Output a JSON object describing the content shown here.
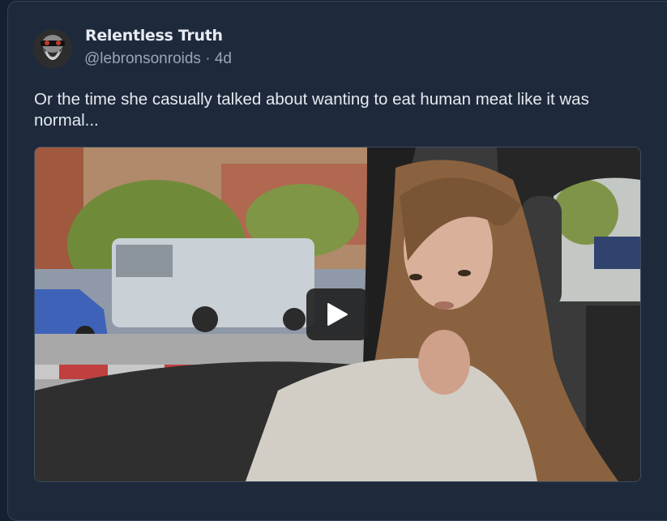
{
  "post": {
    "author": {
      "display_name": "Relentless Truth",
      "handle": "@lebronsonroids",
      "age": "4d",
      "separator": " · "
    },
    "text": "Or the time she casually talked about wanting to eat human meat like it was normal...",
    "media": {
      "type": "video",
      "play_icon": "play-icon"
    }
  },
  "colors": {
    "background": "#152030",
    "card": "#1e2a3c",
    "text_primary": "#e8ecf2",
    "text_secondary": "#9aa5b5"
  }
}
